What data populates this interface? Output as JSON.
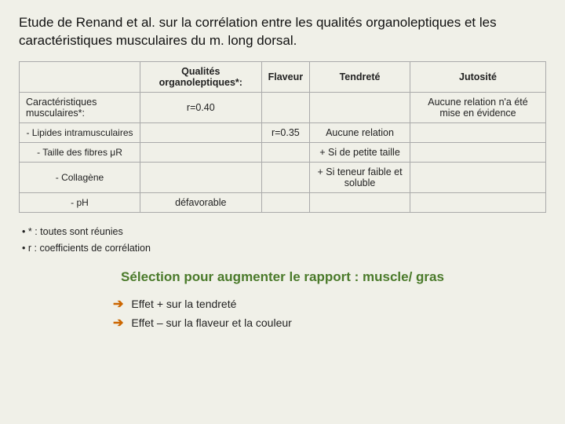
{
  "title": "Etude de Renand et al. sur la corrélation entre les qualités organoleptiques et les caractéristiques musculaires du m. long dorsal.",
  "table": {
    "col_headers": [
      "Qualités organoleptiques*:",
      "Flaveur",
      "Tendreté",
      "Jutosité"
    ],
    "rows": [
      {
        "label": "Caractéristiques musculaires*:",
        "label_type": "main",
        "cols": [
          "r=0.40",
          "",
          "",
          "Aucune relation n'a été mise en évidence"
        ]
      },
      {
        "label": "- Lipides intramusculaires",
        "label_type": "sub",
        "cols": [
          "",
          "r=0.35",
          "Aucune relation",
          ""
        ]
      },
      {
        "label": "- Taille des fibres μR",
        "label_type": "sub",
        "cols": [
          "",
          "",
          "+ Si de petite taille",
          ""
        ]
      },
      {
        "label": "- Collagène",
        "label_type": "sub",
        "cols": [
          "",
          "",
          "+ Si teneur faible et soluble",
          ""
        ]
      },
      {
        "label": "- pH",
        "label_type": "sub",
        "cols": [
          "défavorable",
          "",
          "",
          ""
        ]
      }
    ]
  },
  "bullets": [
    "* : toutes sont réunies",
    "r : coefficients de corrélation"
  ],
  "selection_label": "Sélection pour augmenter le rapport :",
  "selection_highlight": "muscle/ gras",
  "effects": [
    "Effet + sur la tendreté",
    "Effet – sur la flaveur et la couleur"
  ],
  "arrow_symbol": "➔"
}
